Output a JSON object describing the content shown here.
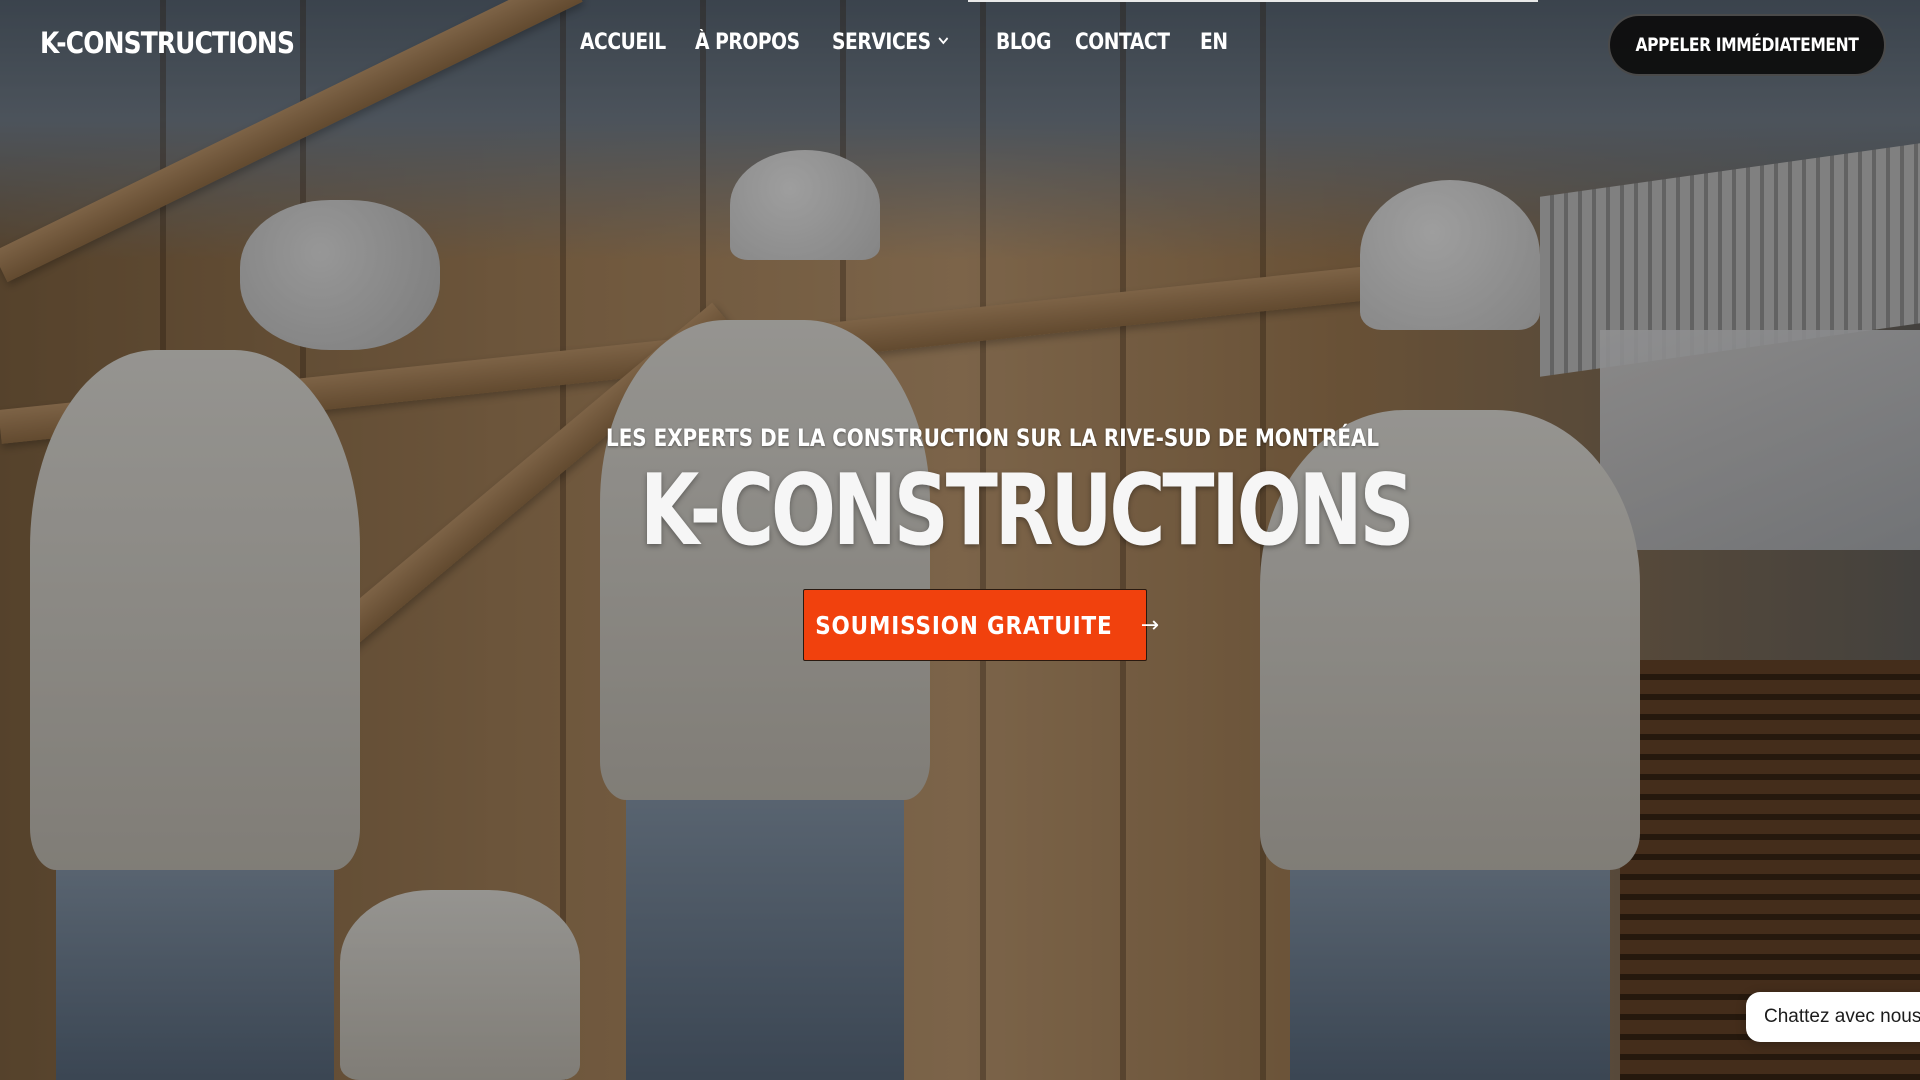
{
  "header": {
    "logo": "K-CONSTRUCTIONS",
    "nav": [
      {
        "label": "ACCUEIL"
      },
      {
        "label": "À PROPOS"
      },
      {
        "label": "SERVICES",
        "has_dropdown": true
      },
      {
        "label": "BLOG"
      },
      {
        "label": "CONTACT"
      },
      {
        "label": "EN"
      }
    ],
    "call_button": "APPELER IMMÉDIATEMENT"
  },
  "hero": {
    "tagline": "LES EXPERTS DE LA CONSTRUCTION SUR LA RIVE-SUD DE MONTRÉAL",
    "title": "K-CONSTRUCTIONS",
    "cta_label": "SOUMISSION GRATUITE",
    "cta_arrow": "→"
  },
  "chat_widget": {
    "label": "Chattez avec nous"
  },
  "icons": {
    "dropdown": "chevron-down-icon",
    "cta": "arrow-right-icon"
  },
  "colors": {
    "accent": "#f1410d",
    "text": "#ffffff",
    "call_button_bg": "#0c0c0c"
  }
}
